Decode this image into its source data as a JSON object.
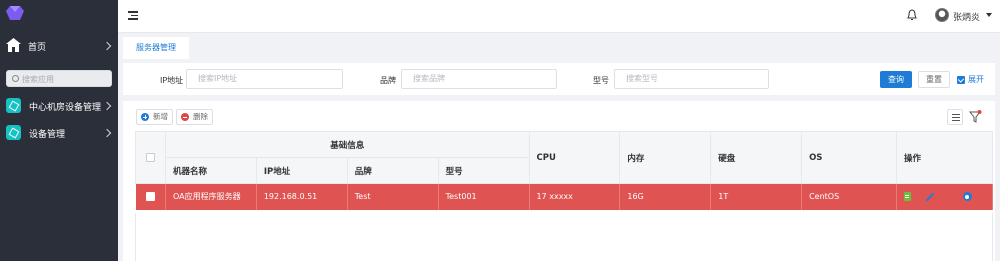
{
  "sidebar": {
    "home_label": "首页",
    "search_placeholder": "搜索应用",
    "items": [
      {
        "label": "中心机房设备管理"
      },
      {
        "label": "设备管理"
      }
    ]
  },
  "header": {
    "username": "张炳炎"
  },
  "tabs": [
    {
      "label": "服务器管理",
      "active": true
    }
  ],
  "search": {
    "fields": [
      {
        "label": "IP地址",
        "placeholder": "搜索IP地址"
      },
      {
        "label": "品牌",
        "placeholder": "搜索品牌"
      },
      {
        "label": "型号",
        "placeholder": "搜索型号"
      }
    ],
    "query_label": "查询",
    "reset_label": "重置",
    "expand_label": "展开"
  },
  "toolbar": {
    "add_label": "新增",
    "delete_label": "删除"
  },
  "table": {
    "group_header": "基础信息",
    "group_columns": [
      "机器名称",
      "IP地址",
      "品牌",
      "型号"
    ],
    "columns": [
      "CPU",
      "内存",
      "硬盘",
      "OS",
      "操作"
    ],
    "rows": [
      {
        "name": "OA应用程序服务器",
        "ip": "192.168.0.51",
        "brand": "Test",
        "model": "Test001",
        "cpu": "17 xxxxx",
        "memory": "16G",
        "disk": "1T",
        "os": "CentOS",
        "highlighted": true
      }
    ]
  },
  "colors": {
    "sidebar_bg": "#2b2f3a",
    "primary": "#1e7bd6",
    "row_highlight": "#e05353",
    "accent_cube": "#13c2c2"
  }
}
